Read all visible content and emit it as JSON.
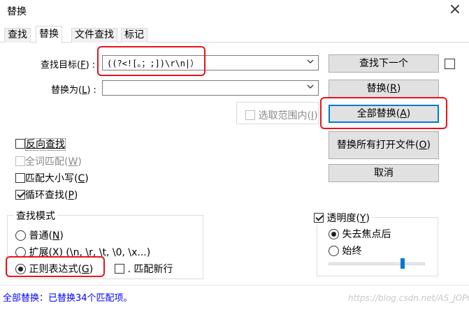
{
  "window": {
    "title": "替换",
    "close_glyph": "×"
  },
  "tabs": [
    {
      "label": "查找"
    },
    {
      "label": "替换",
      "active": true
    },
    {
      "label": "文件查找"
    },
    {
      "label": "标记"
    }
  ],
  "find": {
    "label_text": "查找目标(",
    "label_key": "F",
    "label_end": ") :",
    "value": "((?<![。；;])\\r\\n|）"
  },
  "replace": {
    "label_text": "替换为(",
    "label_key": "L",
    "label_end": ") :",
    "value": ""
  },
  "in_selection": {
    "label": "选取范围内(",
    "key": "I",
    "end": ")",
    "checked": false
  },
  "buttons": {
    "find_next": "查找下一个",
    "replace_text": "替换(",
    "replace_key": "R",
    "replace_end": ")",
    "replace_all_text": "全部替换(",
    "replace_all_key": "A",
    "replace_all_end": ")",
    "replace_all_open_text": "替换所有打开文件(",
    "replace_all_open_key": "O",
    "replace_all_open_end": ")",
    "cancel": "取消"
  },
  "options": {
    "backward": {
      "label": "反向查找",
      "checked": false
    },
    "whole_word": {
      "label_text": "全词匹配(",
      "key": "W",
      "end": ")",
      "checked": false,
      "disabled": true
    },
    "match_case": {
      "label_text": "匹配大小写(",
      "key": "C",
      "end": ")",
      "checked": false
    },
    "wrap": {
      "label_text": "循环查找(",
      "key": "P",
      "end": ")",
      "checked": true
    }
  },
  "search_mode": {
    "title": "查找模式",
    "normal": {
      "label_text": "普通(",
      "key": "N",
      "end": ")",
      "selected": false
    },
    "extended": {
      "label_text": "扩展(",
      "key": "X",
      "end": ") (\\n, \\r, \\t, \\0, \\x...)",
      "selected": false
    },
    "regex": {
      "label_text": "正则表达式(",
      "key": "G",
      "end": ")",
      "selected": true
    },
    "dot_newline": {
      "label": ". 匹配新行",
      "checked": false
    }
  },
  "transparency": {
    "label_text": "透明度(",
    "key": "Y",
    "end": ")",
    "checked": true,
    "on_lose_focus": {
      "label": "失去焦点后",
      "selected": true
    },
    "always": {
      "label": "始终",
      "selected": false
    },
    "slider_level": 0.78
  },
  "status": {
    "text": "全部替换：已替换34个匹配项。"
  },
  "watermark": "https://blog.csdn.net/AS_JOPO"
}
